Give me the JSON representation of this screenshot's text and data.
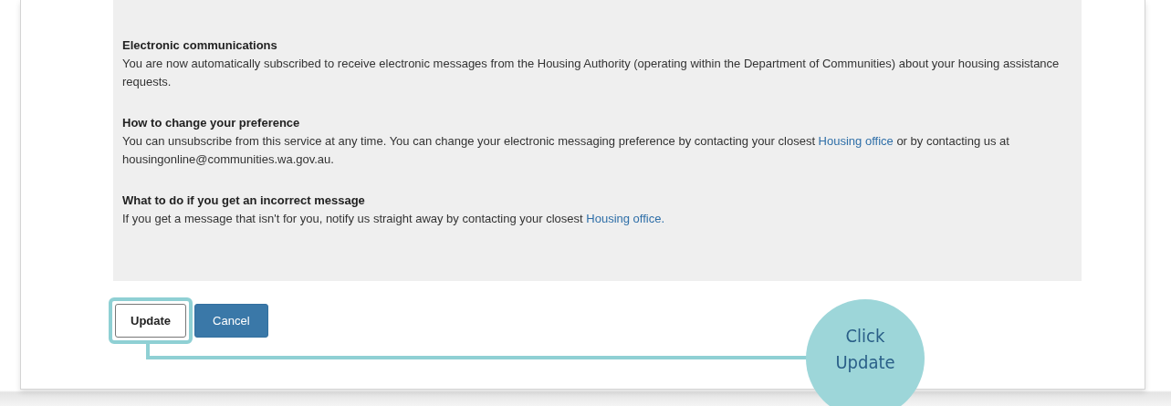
{
  "sections": [
    {
      "heading": "Electronic communications",
      "body": [
        {
          "kind": "text",
          "text": "You are now automatically subscribed to receive electronic messages from the Housing Authority (operating within the Department of Communities) about your housing assistance requests."
        }
      ]
    },
    {
      "heading": "How to change your preference",
      "body": [
        {
          "kind": "text",
          "text": "You can unsubscribe from this service at any time. You can change your electronic messaging preference by contacting your closest "
        },
        {
          "kind": "link",
          "text": "Housing office"
        },
        {
          "kind": "text",
          "text": " or by contacting us at housingonline@communities.wa.gov.au."
        }
      ]
    },
    {
      "heading": "What to do if you get an incorrect message",
      "body": [
        {
          "kind": "text",
          "text": "If you get a message that isn't for you, notify us straight away by contacting your closest "
        },
        {
          "kind": "link",
          "text": "Housing office."
        }
      ]
    }
  ],
  "buttons": [
    {
      "label": "Update",
      "kind": "secondary",
      "highlighted": true
    },
    {
      "label": "Cancel",
      "kind": "primary",
      "highlighted": false
    }
  ],
  "callout": {
    "text": "Click Update"
  }
}
